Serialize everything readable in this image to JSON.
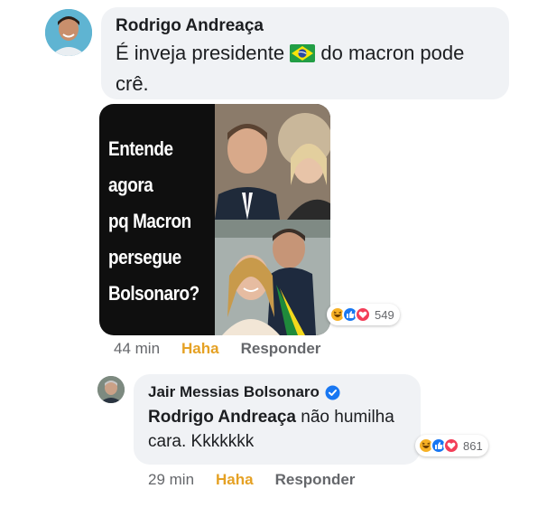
{
  "comment": {
    "author": "Rodrigo Andreaça",
    "text_before_flag": "É inveja presidente",
    "text_after_flag": "do macron pode crê.",
    "flag_icon": "brazil-flag-icon",
    "image": {
      "text_lines": [
        "Entende",
        "agora",
        "pq Macron",
        "persegue",
        "Bolsonaro?"
      ]
    },
    "reaction_icons": [
      "haha-icon",
      "like-icon",
      "love-icon"
    ],
    "reaction_count": "549",
    "time": "44 min",
    "haha_label": "Haha",
    "reply_label": "Responder"
  },
  "reply": {
    "author": "Jair Messias Bolsonaro",
    "verified_icon": "verified-badge-icon",
    "mention": "Rodrigo Andreaça",
    "text": "não humilha cara. Kkkkkkk",
    "reaction_icons": [
      "haha-icon",
      "like-icon",
      "love-icon"
    ],
    "reaction_count": "861",
    "time": "29 min",
    "haha_label": "Haha",
    "reply_label": "Responder"
  },
  "colors": {
    "bubble": "#f0f2f5",
    "haha_text": "#e5a124",
    "meta_text": "#65676b",
    "like_blue": "#1877f2",
    "love_red": "#f33e58",
    "haha_yellow": "#f7b125"
  }
}
